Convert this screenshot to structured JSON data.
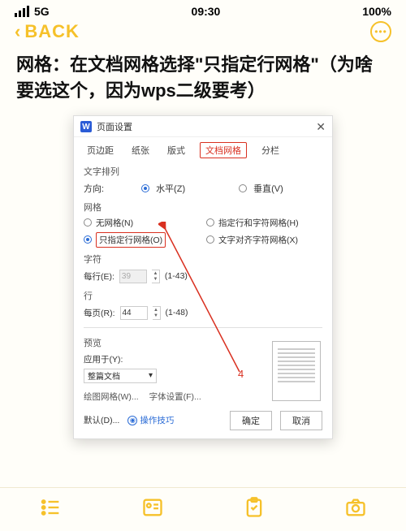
{
  "status": {
    "network": "5G",
    "time": "09:30",
    "battery": "100%"
  },
  "nav": {
    "back": "BACK"
  },
  "heading": "网格：在文档网格选择\"只指定行网格\"（为啥要选这个，因为wps二级要考）",
  "dialog": {
    "title": "页面设置",
    "tabs": [
      "页边距",
      "纸张",
      "版式",
      "文档网格",
      "分栏"
    ],
    "active_tab": "文档网格",
    "text_layout": {
      "label": "文字排列",
      "direction_label": "方向:",
      "horizontal": "水平(Z)",
      "vertical": "垂直(V)"
    },
    "grid": {
      "label": "网格",
      "none": "无网格(N)",
      "line_char": "指定行和字符网格(H)",
      "line_only": "只指定行网格(O)",
      "char_align": "文字对齐字符网格(X)"
    },
    "chars": {
      "label": "字符",
      "per_line": "每行(E):",
      "value": "39",
      "range": "(1-43)"
    },
    "lines": {
      "label": "行",
      "per_page": "每页(R):",
      "value": "44",
      "range": "(1-48)"
    },
    "preview": {
      "label": "预览",
      "apply_to": "应用于(Y):",
      "scope": "整篇文档"
    },
    "links": {
      "draw_grid": "绘图网格(W)...",
      "font": "字体设置(F)..."
    },
    "footer": {
      "default": "默认(D)...",
      "hint": "操作技巧",
      "ok": "确定",
      "cancel": "取消"
    }
  },
  "annotation": {
    "num": "4"
  }
}
